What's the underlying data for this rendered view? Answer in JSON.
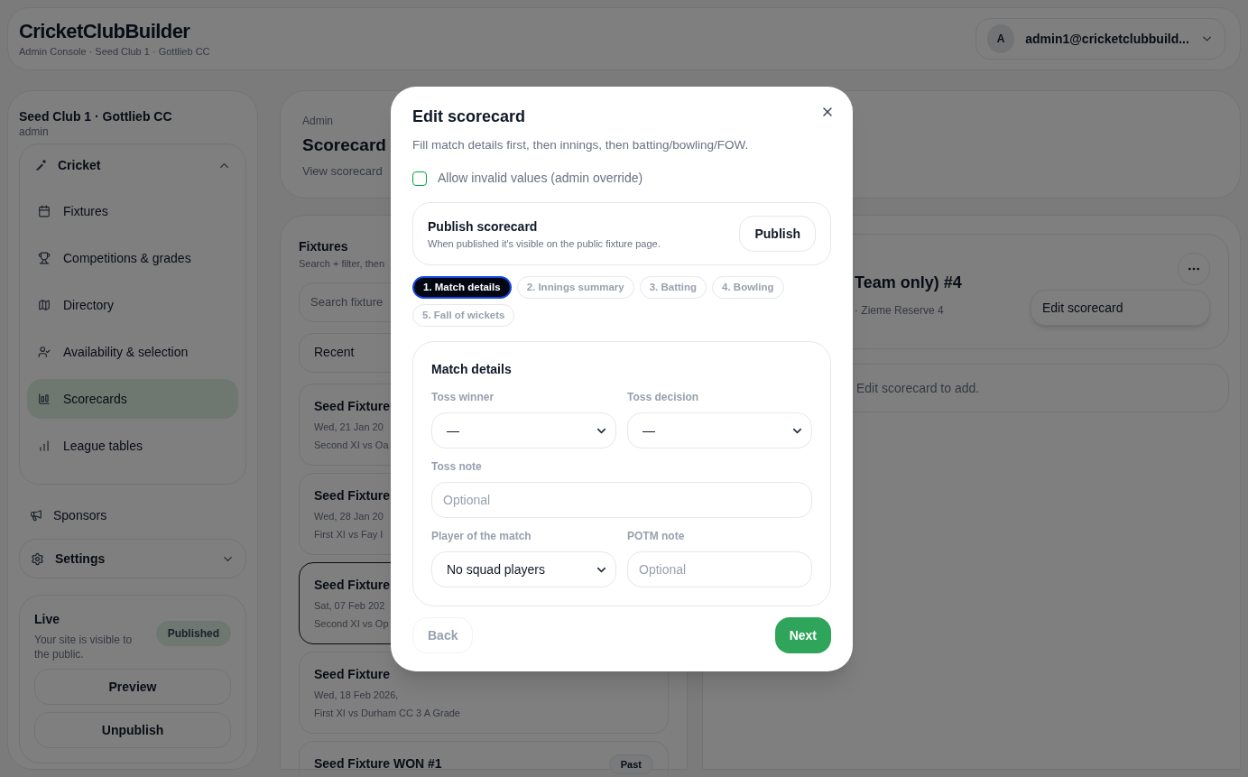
{
  "header": {
    "title": "CricketClubBuilder",
    "subtitle": "Admin Console · Seed Club 1 · Gottlieb CC",
    "user": {
      "initial": "A",
      "email": "admin1@cricketclubbuild..."
    }
  },
  "sidebar": {
    "club": "Seed Club 1 · Gottlieb CC",
    "role": "admin",
    "cricket": {
      "label": "Cricket",
      "expanded": true,
      "items": [
        {
          "label": "Fixtures",
          "selected": false
        },
        {
          "label": "Competitions & grades",
          "selected": false
        },
        {
          "label": "Directory",
          "selected": false
        },
        {
          "label": "Availability & selection",
          "selected": false
        },
        {
          "label": "Scorecards",
          "selected": true
        },
        {
          "label": "League tables",
          "selected": false
        }
      ]
    },
    "sponsors": "Sponsors",
    "settings": {
      "label": "Settings",
      "expanded": false
    },
    "live": {
      "title": "Live",
      "text": "Your site is visible to the public.",
      "badge": "Published",
      "buttons": [
        "Preview",
        "Unpublish"
      ]
    }
  },
  "page_header": {
    "eyebrow": "Admin",
    "title": "Scorecard",
    "subtitle": "View scorecard"
  },
  "fixtures": {
    "title": "Fixtures",
    "subtitle": "Search + filter, then",
    "search": {
      "placeholder": "Search fixture"
    },
    "filter": "Recent",
    "items": [
      {
        "title": "Seed Fixture",
        "date": "Wed, 21 Jan 20",
        "teams": "Second XI vs Oa",
        "selected": false
      },
      {
        "title": "Seed Fixture",
        "date": "Wed, 28 Jan 20",
        "teams": "First XI vs Fay I",
        "selected": false
      },
      {
        "title": "Seed Fixture",
        "date": "Sat, 07 Feb 202",
        "teams": "Second XI vs Op",
        "selected": true
      },
      {
        "title": "Seed Fixture",
        "date": "Wed, 18 Feb 2026,",
        "teams": "First XI vs Durham CC 3 A Grade",
        "selected": false
      },
      {
        "title": "Seed Fixture WON #1",
        "badge": "Past",
        "selected": false
      }
    ]
  },
  "detail": {
    "title": "Team only) #4",
    "meta": "· Zieme Reserve 4",
    "menu_item": "Edit scorecard",
    "notice": "Edit scorecard to add."
  },
  "modal": {
    "title": "Edit scorecard",
    "description": "Fill match details first, then innings, then batting/bowling/FOW.",
    "override": {
      "label": "Allow invalid values (admin override)",
      "checked": false
    },
    "publish": {
      "title": "Publish scorecard",
      "text": "When published it's visible on the public fixture page.",
      "button": "Publish"
    },
    "steps": [
      {
        "label": "1. Match details",
        "selected": true
      },
      {
        "label": "2. Innings summary",
        "selected": false
      },
      {
        "label": "3. Batting",
        "selected": false
      },
      {
        "label": "4. Bowling",
        "selected": false
      },
      {
        "label": "5. Fall of wickets",
        "selected": false
      }
    ],
    "section": {
      "title": "Match details",
      "rows": [
        [
          {
            "label": "Toss winner",
            "kind": "select",
            "value": "—"
          },
          {
            "label": "Toss decision",
            "kind": "select",
            "value": "—"
          }
        ],
        [
          {
            "label": "Toss note",
            "kind": "text",
            "placeholder": "Optional"
          }
        ],
        [
          {
            "label": "Player of the match",
            "kind": "select",
            "value": "No squad players"
          },
          {
            "label": "POTM note",
            "kind": "text",
            "placeholder": "Optional"
          }
        ]
      ]
    },
    "back": {
      "label": "Back",
      "disabled": true
    },
    "next": "Next"
  }
}
